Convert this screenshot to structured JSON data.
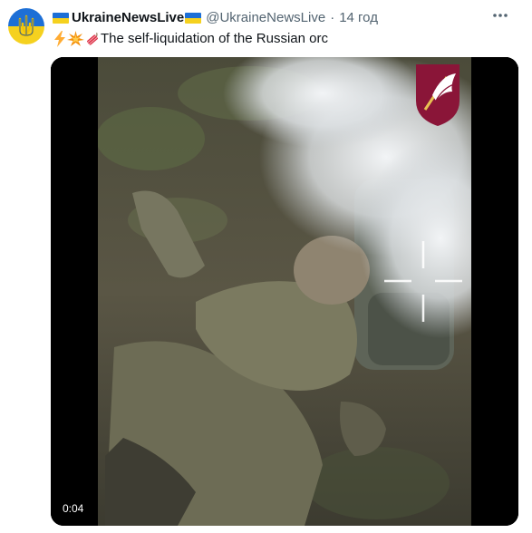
{
  "tweet": {
    "display_name": "UkraineNewsLive",
    "handle": "@UkraineNewsLive",
    "separator": "·",
    "time": "14 год",
    "text": "The self-liquidation of the Russian orc",
    "emojis": [
      "zap",
      "collision",
      "firecracker"
    ]
  },
  "media": {
    "type": "video",
    "duration": "0:04"
  },
  "colors": {
    "flag_blue": "#1d6fd6",
    "flag_yellow": "#f5d11f",
    "secondary_text": "#536471"
  }
}
